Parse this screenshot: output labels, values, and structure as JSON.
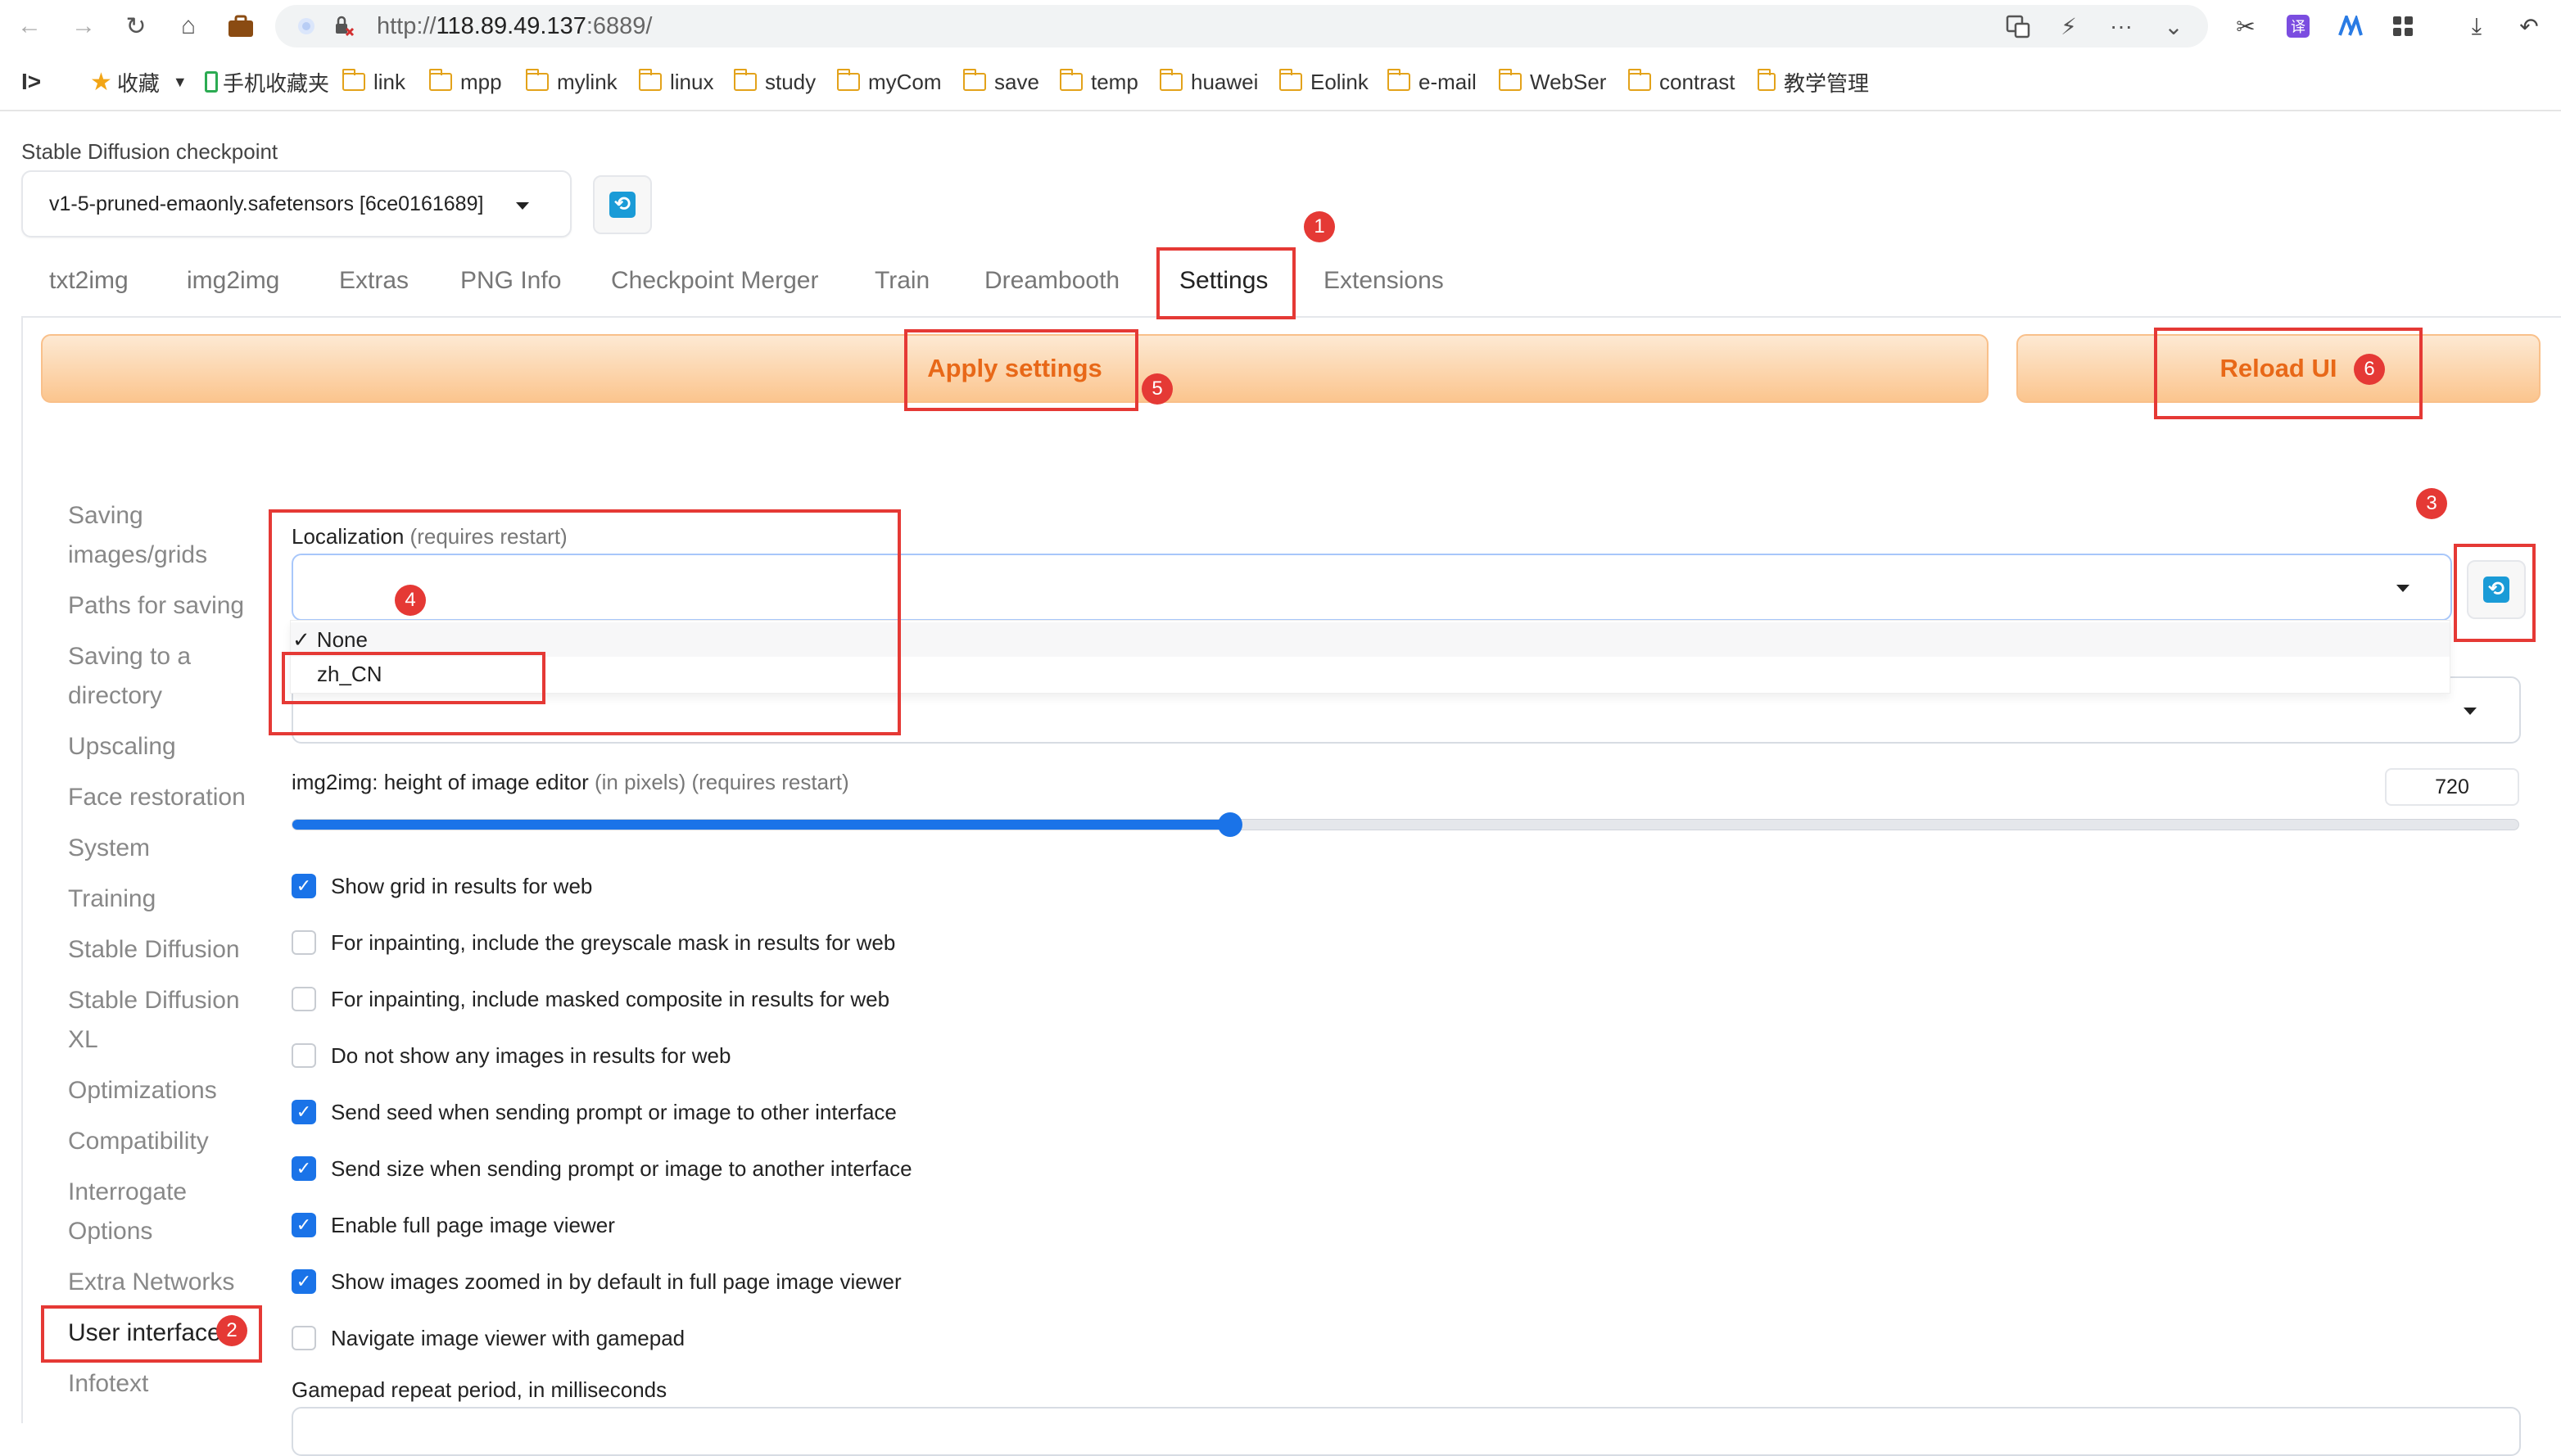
{
  "browser": {
    "url_prefix": "http://",
    "url_host": "118.89.49.137",
    "url_rest": ":6889/",
    "icons": [
      "back-icon",
      "forward-icon",
      "reload-icon",
      "home-icon",
      "briefcase-icon",
      "shield-icon",
      "security-warning-icon",
      "translate-icon",
      "lightning-icon",
      "more-icon",
      "chevron-down-icon",
      "scissors-icon",
      "translate-app-icon",
      "app-icon",
      "grid-icon",
      "download-icon",
      "undo-icon"
    ]
  },
  "bookmarks": {
    "sidebar_toggle": "I>",
    "items": [
      {
        "label": "收藏",
        "icon": "star-icon"
      },
      {
        "label": "手机收藏夹",
        "icon": "phone-icon"
      },
      {
        "label": "link",
        "icon": "folder-icon"
      },
      {
        "label": "mpp",
        "icon": "folder-icon"
      },
      {
        "label": "mylink",
        "icon": "folder-icon"
      },
      {
        "label": "linux",
        "icon": "folder-icon"
      },
      {
        "label": "study",
        "icon": "folder-icon"
      },
      {
        "label": "myCom",
        "icon": "folder-icon"
      },
      {
        "label": "save",
        "icon": "folder-icon"
      },
      {
        "label": "temp",
        "icon": "folder-icon"
      },
      {
        "label": "huawei",
        "icon": "folder-icon"
      },
      {
        "label": "Eolink",
        "icon": "folder-icon"
      },
      {
        "label": "e-mail",
        "icon": "folder-icon"
      },
      {
        "label": "WebSer",
        "icon": "folder-icon"
      },
      {
        "label": "contrast",
        "icon": "folder-icon"
      },
      {
        "label": "教学管理",
        "icon": "folder-icon"
      }
    ]
  },
  "checkpoint": {
    "label": "Stable Diffusion checkpoint",
    "value": "v1-5-pruned-emaonly.safetensors [6ce0161689]"
  },
  "tabs": [
    "txt2img",
    "img2img",
    "Extras",
    "PNG Info",
    "Checkpoint Merger",
    "Train",
    "Dreambooth",
    "Settings",
    "Extensions"
  ],
  "actions": {
    "apply": "Apply settings",
    "reload": "Reload UI"
  },
  "sidebar": [
    "Saving images/grids",
    "Paths for saving",
    "Saving to a directory",
    "Upscaling",
    "Face restoration",
    "System",
    "Training",
    "Stable Diffusion",
    "Stable Diffusion XL",
    "Optimizations",
    "Compatibility",
    "Interrogate Options",
    "Extra Networks",
    "User interface",
    "Infotext"
  ],
  "localization": {
    "label": "Localization",
    "note": "(requires restart)",
    "options": [
      {
        "label": "None",
        "checked": true
      },
      {
        "label": "zh_CN",
        "checked": false
      }
    ]
  },
  "img2img_height": {
    "label": "img2img: height of image editor",
    "note": "(in pixels) (requires restart)",
    "value": "720",
    "fraction": 0.421
  },
  "checkboxes": [
    {
      "label": "Show grid in results for web",
      "checked": true
    },
    {
      "label": "For inpainting, include the greyscale mask in results for web",
      "checked": false
    },
    {
      "label": "For inpainting, include masked composite in results for web",
      "checked": false
    },
    {
      "label": "Do not show any images in results for web",
      "checked": false
    },
    {
      "label": "Send seed when sending prompt or image to other interface",
      "checked": true
    },
    {
      "label": "Send size when sending prompt or image to another interface",
      "checked": true
    },
    {
      "label": "Enable full page image viewer",
      "checked": true
    },
    {
      "label": "Show images zoomed in by default in full page image viewer",
      "checked": true
    },
    {
      "label": "Navigate image viewer with gamepad",
      "checked": false
    }
  ],
  "gamepad_label": "Gamepad repeat period, in milliseconds",
  "annotations": [
    "1",
    "2",
    "3",
    "4",
    "5",
    "6"
  ],
  "colors": {
    "accent": "#1a73e8",
    "orange_text": "#e86818",
    "annotation_red": "#e53935"
  }
}
